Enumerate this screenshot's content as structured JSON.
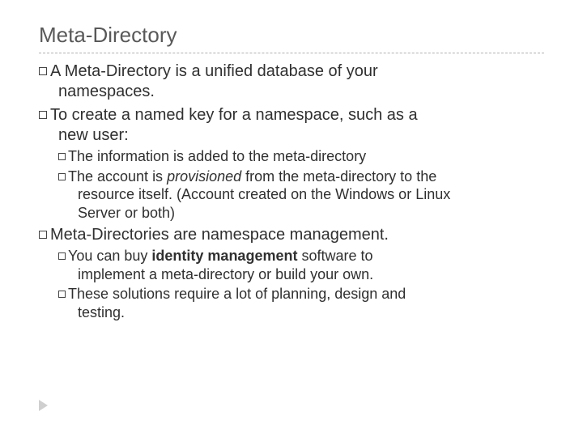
{
  "title": "Meta-Directory",
  "b1": {
    "line1": "A Meta-Directory is a unified database of your",
    "line2": "namespaces."
  },
  "b2": {
    "line1": "To create a named key for a namespace, such as a",
    "line2": "new user:"
  },
  "b2s1": {
    "line1": "The information is added to the meta-directory"
  },
  "b2s2": {
    "pre": "The account is ",
    "em": "provisioned",
    "post": " from the meta-directory to the",
    "line2": "resource itself. (Account created on the Windows or Linux",
    "line3": "Server or both)"
  },
  "b3": {
    "line1": "Meta-Directories are namespace management."
  },
  "b3s1": {
    "pre": "You can buy ",
    "bold": "identity management",
    "post": " software to",
    "line2": "implement a meta-directory or build your own."
  },
  "b3s2": {
    "line1": "These solutions require a lot of planning, design and",
    "line2": "testing."
  }
}
